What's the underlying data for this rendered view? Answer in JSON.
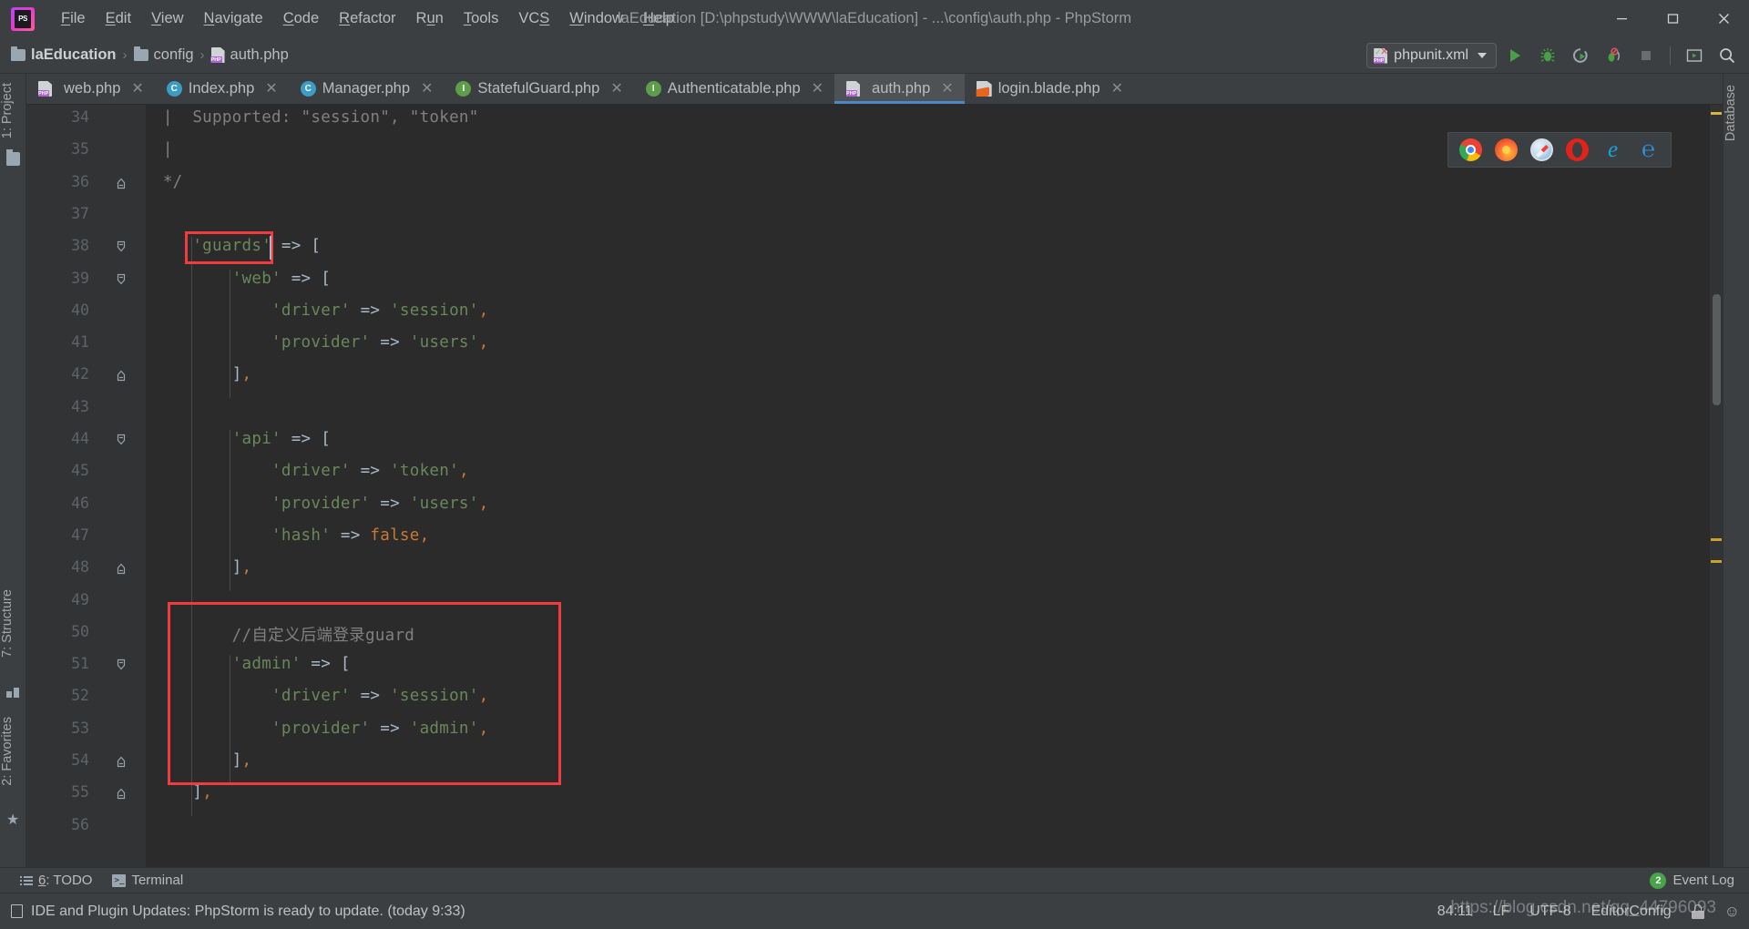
{
  "window": {
    "title": "laEducation [D:\\phpstudy\\WWW\\laEducation] - ...\\config\\auth.php - PhpStorm",
    "app_logo": "phpstorm-logo",
    "minimize": "—",
    "maximize": "▭",
    "close": "✕"
  },
  "menubar": {
    "items": [
      {
        "label": "File",
        "mnemonic": "F"
      },
      {
        "label": "Edit",
        "mnemonic": "E"
      },
      {
        "label": "View",
        "mnemonic": "V"
      },
      {
        "label": "Navigate",
        "mnemonic": "N"
      },
      {
        "label": "Code",
        "mnemonic": "C"
      },
      {
        "label": "Refactor",
        "mnemonic": "R"
      },
      {
        "label": "Run",
        "mnemonic": "u"
      },
      {
        "label": "Tools",
        "mnemonic": "T"
      },
      {
        "label": "VCS",
        "mnemonic": "S"
      },
      {
        "label": "Window",
        "mnemonic": "W"
      },
      {
        "label": "Help",
        "mnemonic": "H"
      }
    ]
  },
  "breadcrumb": {
    "items": [
      {
        "label": "laEducation",
        "icon": "folder-icon",
        "bold": true
      },
      {
        "label": "config",
        "icon": "folder-icon",
        "bold": false
      },
      {
        "label": "auth.php",
        "icon": "php-file-icon",
        "bold": false
      }
    ],
    "separator": "›"
  },
  "toolbar": {
    "run_configuration": "phpunit.xml",
    "buttons": [
      {
        "name": "run-button",
        "icon": "play-icon"
      },
      {
        "name": "debug-button",
        "icon": "bug-icon"
      },
      {
        "name": "run-with-coverage",
        "icon": "coverage-icon"
      },
      {
        "name": "profile-button",
        "icon": "profile-icon"
      },
      {
        "name": "stop-button",
        "icon": "stop-icon"
      },
      {
        "name": "open-preview-button",
        "icon": "preview-icon"
      },
      {
        "name": "search-everywhere",
        "icon": "search-icon"
      }
    ]
  },
  "left_strip": {
    "project": "1: Project",
    "structure": "7: Structure",
    "favorites": "2: Favorites"
  },
  "right_strip": {
    "database": "Database"
  },
  "editor_tabs": [
    {
      "label": "web.php",
      "icon": "php-file-icon",
      "active": false
    },
    {
      "label": "Index.php",
      "icon": "php-class-icon",
      "active": false
    },
    {
      "label": "Manager.php",
      "icon": "php-class-icon",
      "active": false
    },
    {
      "label": "StatefulGuard.php",
      "icon": "php-interface-icon",
      "active": false
    },
    {
      "label": "Authenticatable.php",
      "icon": "php-interface-icon",
      "active": false
    },
    {
      "label": "auth.php",
      "icon": "php-file-icon",
      "active": true
    },
    {
      "label": "login.blade.php",
      "icon": "blade-file-icon",
      "active": false
    }
  ],
  "tab_close_glyph": "✕",
  "browser_bar": {
    "browsers": [
      {
        "name": "chrome-icon",
        "label": "Chrome"
      },
      {
        "name": "firefox-icon",
        "label": "Firefox"
      },
      {
        "name": "safari-icon",
        "label": "Safari"
      },
      {
        "name": "opera-icon",
        "label": "Opera"
      },
      {
        "name": "ie-icon",
        "label": "Internet Explorer",
        "glyph": "e"
      },
      {
        "name": "edge-icon",
        "label": "Edge",
        "glyph": "℮"
      }
    ]
  },
  "code": {
    "first_line_number": 34,
    "lines": [
      {
        "n": 34,
        "fold": null,
        "text": " |  Supported: \"session\", \"token\"",
        "kind": "doc"
      },
      {
        "n": 35,
        "fold": null,
        "text": " |",
        "kind": "doc"
      },
      {
        "n": 36,
        "fold": "end",
        "text": " */",
        "kind": "doc"
      },
      {
        "n": 37,
        "fold": null,
        "text": "",
        "kind": "plain"
      },
      {
        "n": 38,
        "fold": "start",
        "text": "    'guards' => [",
        "kind": "code"
      },
      {
        "n": 39,
        "fold": "start",
        "text": "        'web' => [",
        "kind": "code"
      },
      {
        "n": 40,
        "fold": null,
        "text": "            'driver' => 'session',",
        "kind": "code"
      },
      {
        "n": 41,
        "fold": null,
        "text": "            'provider' => 'users',",
        "kind": "code"
      },
      {
        "n": 42,
        "fold": "end",
        "text": "        ],",
        "kind": "code"
      },
      {
        "n": 43,
        "fold": null,
        "text": "",
        "kind": "plain"
      },
      {
        "n": 44,
        "fold": "start",
        "text": "        'api' => [",
        "kind": "code"
      },
      {
        "n": 45,
        "fold": null,
        "text": "            'driver' => 'token',",
        "kind": "code"
      },
      {
        "n": 46,
        "fold": null,
        "text": "            'provider' => 'users',",
        "kind": "code"
      },
      {
        "n": 47,
        "fold": null,
        "text": "            'hash' => false,",
        "kind": "code"
      },
      {
        "n": 48,
        "fold": "end",
        "text": "        ],",
        "kind": "code"
      },
      {
        "n": 49,
        "fold": null,
        "text": "",
        "kind": "plain"
      },
      {
        "n": 50,
        "fold": null,
        "text": "        //自定义后端登录guard",
        "kind": "comment"
      },
      {
        "n": 51,
        "fold": "start",
        "text": "        'admin' => [",
        "kind": "code"
      },
      {
        "n": 52,
        "fold": null,
        "text": "            'driver' => 'session',",
        "kind": "code"
      },
      {
        "n": 53,
        "fold": null,
        "text": "            'provider' => 'admin',",
        "kind": "code"
      },
      {
        "n": 54,
        "fold": "end",
        "text": "        ],",
        "kind": "code"
      },
      {
        "n": 55,
        "fold": "end",
        "text": "    ],",
        "kind": "code"
      },
      {
        "n": 56,
        "fold": null,
        "text": "",
        "kind": "plain"
      }
    ],
    "annotations": [
      {
        "name": "guards-key-highlight",
        "color": "#f03c3c"
      },
      {
        "name": "admin-guard-block-highlight",
        "color": "#f03c3c"
      }
    ]
  },
  "toolwindow_bar": {
    "todo": {
      "label": "6: TODO",
      "mnemonic": "6"
    },
    "terminal": "Terminal",
    "event_log": {
      "label": "Event Log",
      "count": "2"
    }
  },
  "statusbar": {
    "message": "IDE and Plugin Updates: PhpStorm is ready to update. (today 9:33)",
    "caret_position": "84:11",
    "line_separator": "LF",
    "encoding": "UTF-8",
    "config_label": "EditorConfig",
    "lock_icon": "lock-icon",
    "face_icon": "face-icon"
  },
  "watermark": "https://blog.csdn.net/qq_44796093",
  "colors": {
    "editor_bg": "#2b2b2b",
    "gutter_bg": "#313335",
    "chrome_bg": "#3c3f41",
    "active_tab_bg": "#4e5254",
    "tab_underline": "#4a88c7",
    "string_green": "#6a8759",
    "keyword_orange": "#cc7832",
    "default_fg": "#a9b7c6",
    "comment_gray": "#808080",
    "line_number": "#606366",
    "annotation_red": "#f03c3c"
  }
}
